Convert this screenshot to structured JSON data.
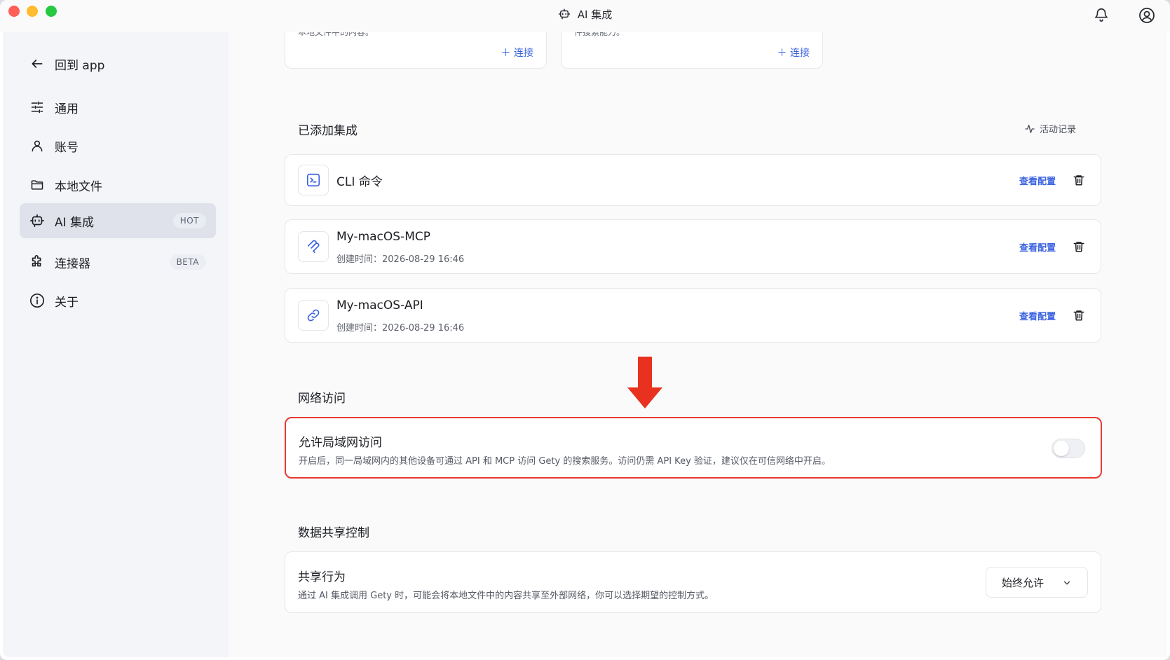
{
  "window": {
    "title": "AI 集成"
  },
  "sidebar": {
    "back_label": "回到 app",
    "items": [
      {
        "label": "通用",
        "icon": "sliders-icon"
      },
      {
        "label": "账号",
        "icon": "user-icon"
      },
      {
        "label": "本地文件",
        "icon": "folder-icon"
      },
      {
        "label": "AI 集成",
        "icon": "robot-icon",
        "badge": "HOT",
        "active": true
      },
      {
        "label": "连接器",
        "icon": "puzzle-icon",
        "badge": "BETA"
      },
      {
        "label": "关于",
        "icon": "info-icon"
      }
    ]
  },
  "top_cards": [
    {
      "fragment": "本地文件中的内容。",
      "connect_label": "连接"
    },
    {
      "fragment": "件搜索能力。",
      "connect_label": "连接"
    }
  ],
  "added": {
    "title": "已添加集成",
    "activity_label": "活动记录",
    "items": [
      {
        "name": "CLI 命令",
        "icon": "terminal-icon",
        "view_label": "查看配置"
      },
      {
        "name": "My-macOS-MCP",
        "date_label": "创建时间：",
        "date": "2026-08-29 16:46",
        "icon": "mcp-icon",
        "view_label": "查看配置"
      },
      {
        "name": "My-macOS-API",
        "date_label": "创建时间：",
        "date": "2026-08-29 16:46",
        "icon": "link-icon",
        "view_label": "查看配置"
      }
    ]
  },
  "network": {
    "title": "网络访问",
    "card_title": "允许局域网访问",
    "card_desc": "开启后，同一局域网内的其他设备可通过 API 和 MCP 访问 Gety 的搜索服务。访问仍需 API Key 验证，建议仅在可信网络中开启。",
    "toggle_on": false
  },
  "sharing": {
    "title": "数据共享控制",
    "card_title": "共享行为",
    "card_desc": "通过 AI 集成调用 Gety 时，可能会将本地文件中的内容共享至外部网络，你可以选择期望的控制方式。",
    "select_value": "始终允许"
  },
  "colors": {
    "accent": "#3b63e0",
    "highlight_red": "#e8382f",
    "arrow_red": "#e8321f"
  }
}
